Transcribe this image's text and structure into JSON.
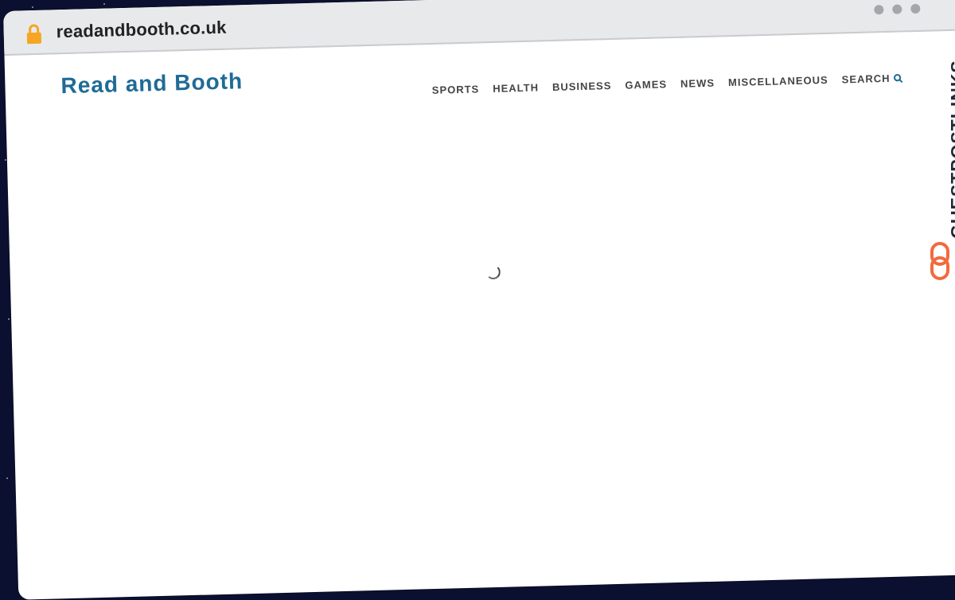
{
  "browser": {
    "url": "readandbooth.co.uk",
    "icons": {
      "lock": "lock-icon",
      "dots": "window-dots-icon"
    }
  },
  "site": {
    "title": "Read and Booth",
    "title_color": "#1f6b96",
    "nav": [
      {
        "label": "SPORTS"
      },
      {
        "label": "HEALTH"
      },
      {
        "label": "BUSINESS"
      },
      {
        "label": "GAMES"
      },
      {
        "label": "NEWS"
      },
      {
        "label": "MISCELLANEOUS"
      },
      {
        "label": "SEARCH"
      }
    ]
  },
  "badge": {
    "text": "GUESTPOSTLINKS",
    "accent_color": "#f26a3d"
  },
  "colors": {
    "background": "#0b1030",
    "lock": "#f5a623"
  }
}
